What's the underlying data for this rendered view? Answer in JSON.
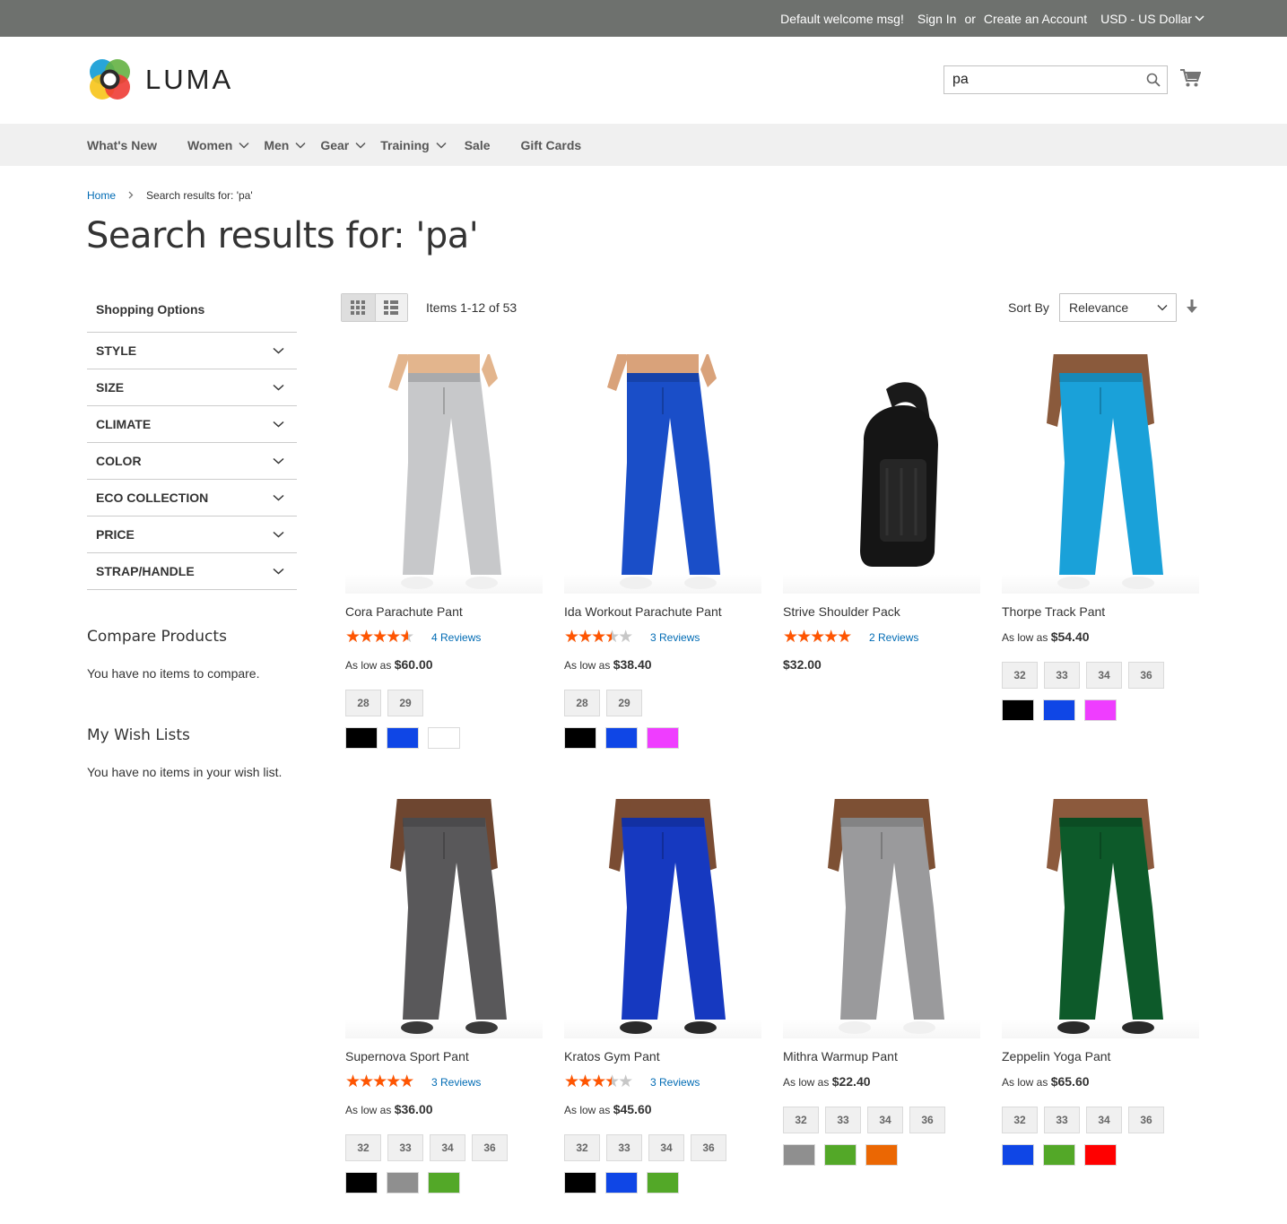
{
  "topbar": {
    "welcome": "Default welcome msg!",
    "sign_in": "Sign In",
    "or": "or",
    "create_account": "Create an Account",
    "currency": "USD - US Dollar"
  },
  "header": {
    "logo_text": "LUMA",
    "search_value": "pa"
  },
  "nav": [
    "What's New",
    "Women",
    "Men",
    "Gear",
    "Training",
    "Sale",
    "Gift Cards"
  ],
  "breadcrumb": {
    "home": "Home",
    "current": "Search results for: 'pa'"
  },
  "page_title": "Search results for: 'pa'",
  "sidebar": {
    "shopping_options": "Shopping Options",
    "filters": [
      "STYLE",
      "SIZE",
      "CLIMATE",
      "COLOR",
      "ECO COLLECTION",
      "PRICE",
      "STRAP/HANDLE"
    ],
    "compare_title": "Compare Products",
    "compare_text": "You have no items to compare.",
    "wishlist_title": "My Wish Lists",
    "wishlist_text": "You have no items in your wish list."
  },
  "toolbar": {
    "amount": "Items 1-12 of 53",
    "sort_label": "Sort By",
    "sort_value": "Relevance"
  },
  "products": [
    {
      "name": "Cora Parachute Pant",
      "rating": 0.8,
      "reviews": "4  Reviews",
      "price_prefix": "As low as",
      "price": "$60.00",
      "sizes": [
        "28",
        "29"
      ],
      "colors": [
        "#000000",
        "#0f46e6",
        "#ffffff"
      ]
    },
    {
      "name": "Ida Workout Parachute Pant",
      "rating": 0.6,
      "reviews": "3  Reviews",
      "price_prefix": "As low as",
      "price": "$38.40",
      "sizes": [
        "28",
        "29"
      ],
      "colors": [
        "#000000",
        "#0f46e6",
        "#ef3dff"
      ]
    },
    {
      "name": "Strive Shoulder Pack",
      "rating": 0.9,
      "reviews": "2  Reviews",
      "price_prefix": "",
      "price": "$32.00",
      "sizes": [],
      "colors": []
    },
    {
      "name": "Thorpe Track Pant",
      "rating": null,
      "reviews": "",
      "price_prefix": "As low as",
      "price": "$54.40",
      "sizes": [
        "32",
        "33",
        "34",
        "36"
      ],
      "colors": [
        "#000000",
        "#0f46e6",
        "#ef3dff"
      ]
    },
    {
      "name": "Supernova Sport Pant",
      "rating": 0.9,
      "reviews": "3  Reviews",
      "price_prefix": "As low as",
      "price": "$36.00",
      "sizes": [
        "32",
        "33",
        "34",
        "36"
      ],
      "colors": [
        "#000000",
        "#8f8f8f",
        "#53a828"
      ]
    },
    {
      "name": "Kratos Gym Pant",
      "rating": 0.6,
      "reviews": "3  Reviews",
      "price_prefix": "As low as",
      "price": "$45.60",
      "sizes": [
        "32",
        "33",
        "34",
        "36"
      ],
      "colors": [
        "#000000",
        "#0f46e6",
        "#53a828"
      ]
    },
    {
      "name": "Mithra Warmup Pant",
      "rating": null,
      "reviews": "",
      "price_prefix": "As low as",
      "price": "$22.40",
      "sizes": [
        "32",
        "33",
        "34",
        "36"
      ],
      "colors": [
        "#8f8f8f",
        "#53a828",
        "#eb6703"
      ]
    },
    {
      "name": "Zeppelin Yoga Pant",
      "rating": null,
      "reviews": "",
      "price_prefix": "As low as",
      "price": "$65.60",
      "sizes": [
        "32",
        "33",
        "34",
        "36"
      ],
      "colors": [
        "#0f46e6",
        "#53a828",
        "#ff0000"
      ]
    }
  ],
  "product_images": [
    "light-gray-pant-icon",
    "royal-blue-jogger-icon",
    "black-shoulder-pack-icon",
    "turquoise-track-pant-icon",
    "charcoal-sport-pant-icon",
    "blue-gym-pant-icon",
    "gray-warmup-pant-icon",
    "green-yoga-pant-icon"
  ]
}
